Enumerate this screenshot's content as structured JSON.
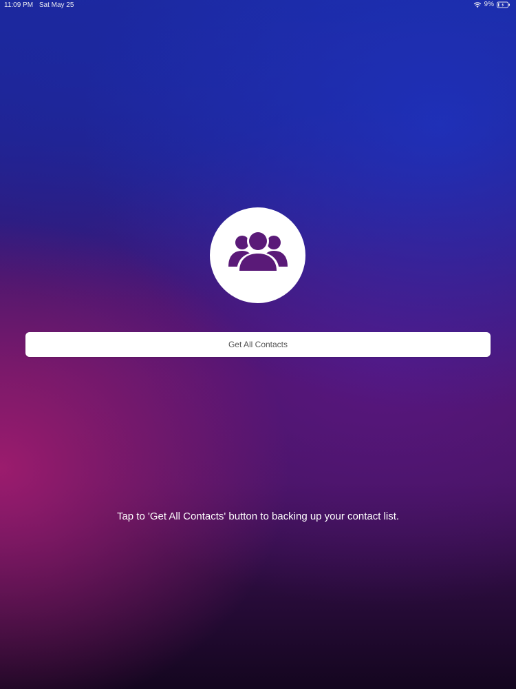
{
  "status_bar": {
    "time": "11:09 PM",
    "date": "Sat May 25",
    "battery_percent": "9%"
  },
  "colors": {
    "accent": "#5a1a78",
    "button_bg": "#ffffff",
    "button_text": "#555555",
    "text": "#ffffff"
  },
  "logo": {
    "icon": "contacts-group-icon"
  },
  "button": {
    "label": "Get All Contacts"
  },
  "instruction": {
    "text": "Tap to 'Get All Contacts' button to backing up your contact list."
  }
}
